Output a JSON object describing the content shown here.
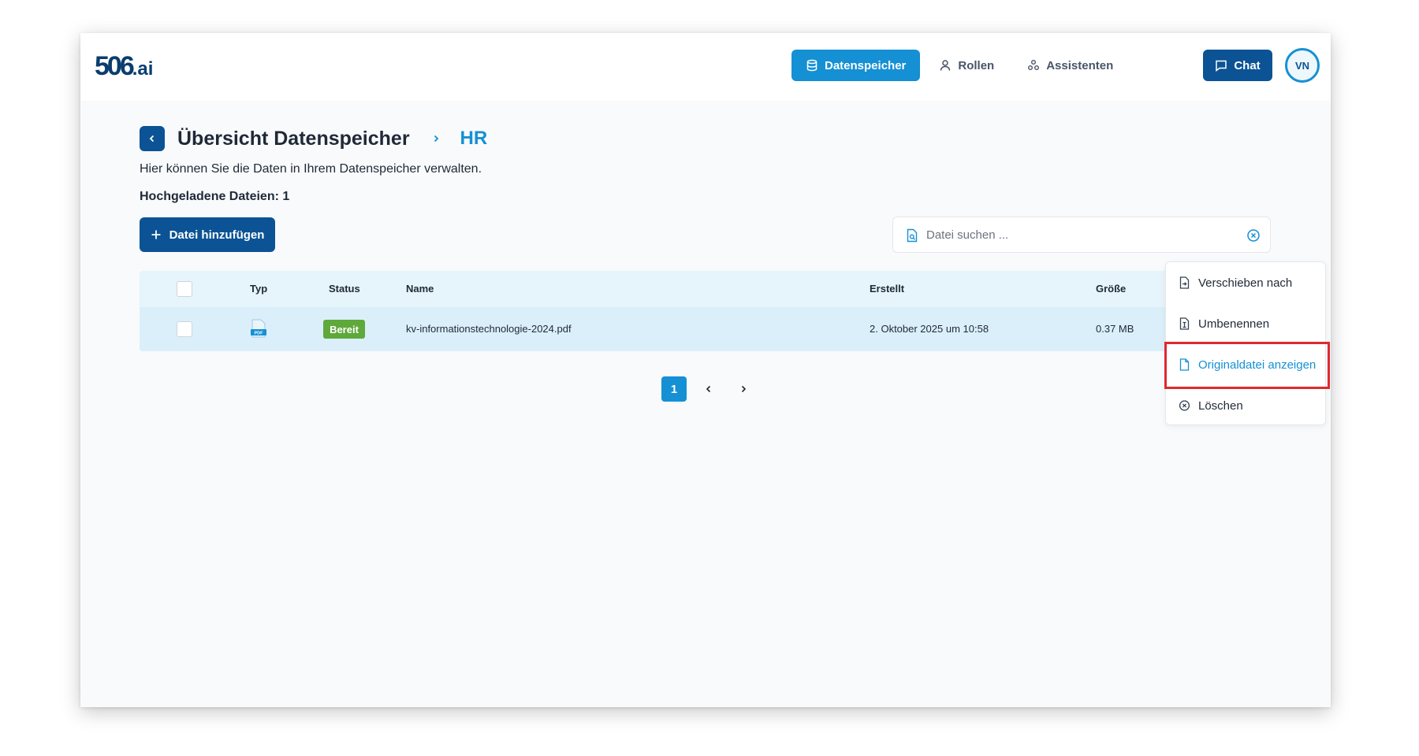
{
  "app": {
    "logo_main": "506",
    "logo_suffix": ".ai"
  },
  "nav": {
    "items": [
      {
        "label": "Datenspeicher",
        "icon": "database-icon",
        "active": true
      },
      {
        "label": "Rollen",
        "icon": "user-icon",
        "active": false
      },
      {
        "label": "Assistenten",
        "icon": "assistants-icon",
        "active": false
      }
    ],
    "chat_label": "Chat",
    "avatar_initials": "VN"
  },
  "page": {
    "title": "Übersicht Datenspeicher",
    "breadcrumb_current": "HR",
    "subtitle": "Hier können Sie die Daten in Ihrem Datenspeicher verwalten.",
    "uploaded_count_label": "Hochgeladene Dateien: 1",
    "add_button_label": "Datei hinzufügen"
  },
  "search": {
    "placeholder": "Datei suchen ...",
    "value": ""
  },
  "table": {
    "headers": {
      "typ": "Typ",
      "status": "Status",
      "name": "Name",
      "erstellt": "Erstellt",
      "groesse": "Größe"
    },
    "rows": [
      {
        "type_icon": "pdf-file-icon",
        "type_label": "PDF",
        "status": "Bereit",
        "name": "kv-informationstechnologie-2024.pdf",
        "created": "2. Oktober 2025 um 10:58",
        "size": "0.37 MB"
      }
    ]
  },
  "pagination": {
    "current_page": "1"
  },
  "context_menu": {
    "items": [
      {
        "label": "Verschieben nach",
        "icon": "file-move-icon"
      },
      {
        "label": "Umbenennen",
        "icon": "file-rename-icon"
      },
      {
        "label": "Originaldatei anzeigen",
        "icon": "file-icon",
        "highlighted": true
      },
      {
        "label": "Löschen",
        "icon": "close-circle-icon"
      }
    ]
  },
  "colors": {
    "primary_dark": "#0b5394",
    "primary": "#1590d4",
    "status_ready": "#5fa83a",
    "highlight_border": "#e0282e"
  }
}
